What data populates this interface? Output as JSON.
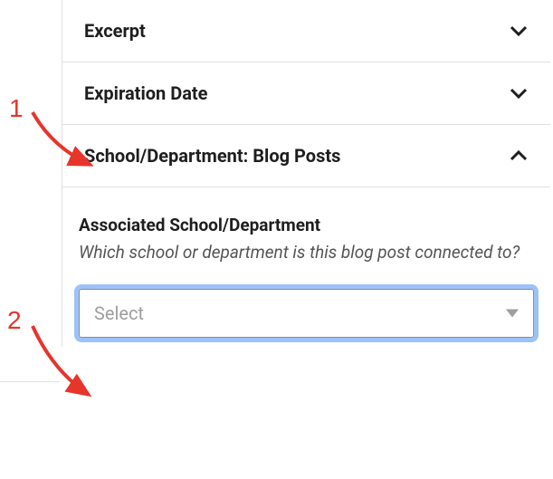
{
  "sections": {
    "excerpt": {
      "title": "Excerpt"
    },
    "expiration": {
      "title": "Expiration Date"
    },
    "blogposts": {
      "title": "School/Department: Blog Posts"
    }
  },
  "field": {
    "label": "Associated School/Department",
    "description": "Which school or department is this blog post connected to?"
  },
  "select": {
    "placeholder": "Select"
  },
  "annotations": {
    "one": "1",
    "two": "2"
  }
}
